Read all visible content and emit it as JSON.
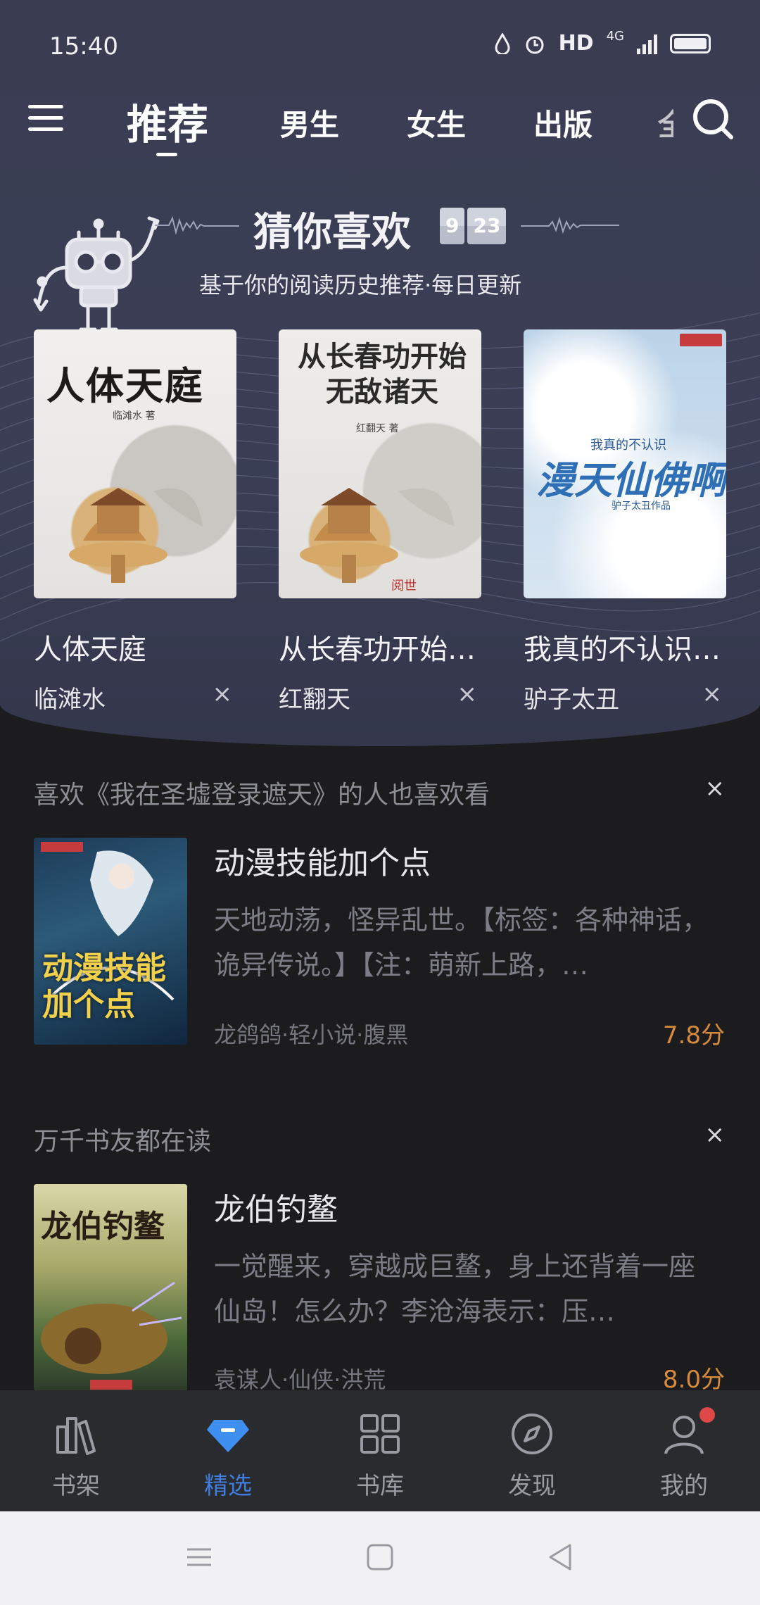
{
  "status": {
    "time": "15:40",
    "hd": "HD",
    "net": "4G"
  },
  "nav": {
    "tabs": [
      "推荐",
      "男生",
      "女生",
      "出版",
      "全"
    ],
    "active": 0
  },
  "guess": {
    "title": "猜你喜欢",
    "date_month": "9",
    "date_day": "23",
    "subtitle": "基于你的阅读历史推荐·每日更新",
    "books": [
      {
        "title": "人体天庭",
        "author": "临滩水",
        "cover_text": "人体天庭",
        "cover_author": "临滩水 著",
        "close": "×"
      },
      {
        "title": "从长春功开始…",
        "author": "红翻天",
        "cover_text": "从长春功开始无敌诸天",
        "cover_author": "红翻天 著",
        "close": "×"
      },
      {
        "title": "我真的不认识…",
        "author": "驴子太丑",
        "cover_text": "漫天仙佛啊",
        "cover_top": "我真的不认识",
        "cover_author": "驴子太丑作品",
        "close": "×"
      }
    ]
  },
  "recs": [
    {
      "header": "喜欢《我在圣墟登录遮天》的人也喜欢看",
      "title": "动漫技能加个点",
      "desc": "天地动荡，怪异乱世。【标签：各种神话，诡异传说。】【注：萌新上路，…",
      "meta": "龙鸽鸽·轻小说·腹黑",
      "score": "7.8分",
      "cover_text": "动漫技能加个点",
      "close": "×"
    },
    {
      "header": "万千书友都在读",
      "title": "龙伯钓鳌",
      "desc": "一觉醒来，穿越成巨鳌，身上还背着一座仙岛！怎么办？李沧海表示：压…",
      "meta": "袁谋人·仙侠·洪荒",
      "score": "8.0分",
      "cover_text": "龙伯钓鳌",
      "close": "×"
    }
  ],
  "bottom_nav": [
    {
      "label": "书架",
      "icon": "bookshelf-icon"
    },
    {
      "label": "精选",
      "icon": "diamond-icon",
      "active": true
    },
    {
      "label": "书库",
      "icon": "grid-icon"
    },
    {
      "label": "发现",
      "icon": "compass-icon"
    },
    {
      "label": "我的",
      "icon": "user-icon",
      "badge": true
    }
  ],
  "colors": {
    "accent": "#3f7ee0",
    "score": "#d58b3b",
    "hero": "#3a3d52"
  }
}
